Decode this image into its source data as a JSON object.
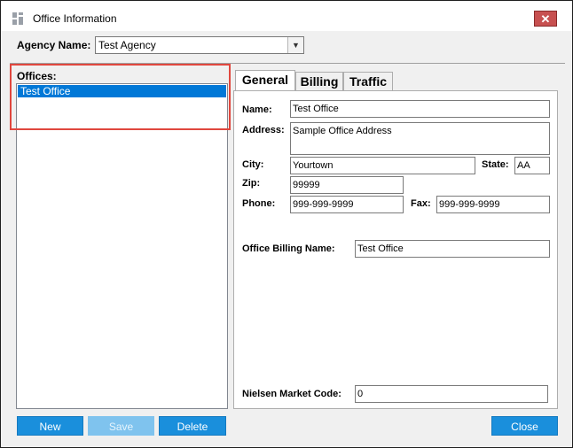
{
  "window": {
    "title": "Office Information",
    "close_glyph": "✕"
  },
  "agency": {
    "label": "Agency Name:",
    "selected": "Test Agency"
  },
  "offices": {
    "label": "Offices:",
    "items": [
      "Test Office"
    ]
  },
  "tabs": [
    "General",
    "Billing",
    "Traffic"
  ],
  "general": {
    "name_label": "Name:",
    "name_value": "Test Office",
    "address_label": "Address:",
    "address_value": "Sample Office Address",
    "city_label": "City:",
    "city_value": "Yourtown",
    "state_label": "State:",
    "state_value": "AA",
    "zip_label": "Zip:",
    "zip_value": "99999",
    "phone_label": "Phone:",
    "phone_value": "999-999-9999",
    "fax_label": "Fax:",
    "fax_value": "999-999-9999",
    "billing_name_label": "Office Billing Name:",
    "billing_name_value": "Test Office",
    "nielsen_label": "Nielsen Market Code:",
    "nielsen_value": "0"
  },
  "buttons": {
    "new": "New",
    "save": "Save",
    "delete": "Delete",
    "close": "Close"
  },
  "colors": {
    "accent": "#1a8fdc",
    "selection": "#0078d7",
    "highlight_box": "#e0473e"
  }
}
